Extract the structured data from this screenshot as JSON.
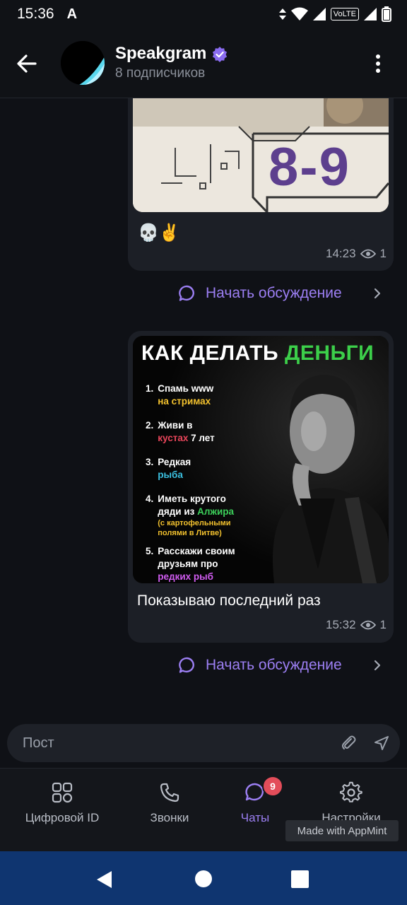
{
  "status_bar": {
    "time": "15:36",
    "volte": "VoLTE"
  },
  "header": {
    "channel_name": "Speakgram",
    "subscribers": "8 подписчиков"
  },
  "posts": [
    {
      "image_label": "8-9",
      "caption": "💀✌️",
      "time": "14:23",
      "views": "1",
      "discuss_label": "Начать обсуждение"
    },
    {
      "image": {
        "title_white": "КАК ДЕЛАТЬ",
        "title_green": "ДЕНЬГИ",
        "items": [
          {
            "num": "1.",
            "text": "Спамь www",
            "highlight": "на стримах",
            "after": "",
            "color": "#f2c12e"
          },
          {
            "num": "2.",
            "text": "Живи в",
            "highlight": "кустах",
            "after": " 7 лет",
            "color": "#e8455a"
          },
          {
            "num": "3.",
            "text": "Редкая",
            "highlight": "рыба",
            "after": "",
            "color": "#3bc0e0"
          },
          {
            "num": "4.",
            "text": "Иметь крутого дяди из",
            "highlight": "Алжира",
            "after": "",
            "color": "#3ccf5a",
            "note": "(с картофельными полями в Литве)"
          },
          {
            "num": "5.",
            "text": "Расскажи своим друзьям про",
            "highlight": "редких рыб",
            "after": "",
            "color": "#d05cf0"
          }
        ]
      },
      "caption": "Показываю последний раз",
      "time": "15:32",
      "views": "1",
      "discuss_label": "Начать обсуждение"
    }
  ],
  "input": {
    "placeholder": "Пост"
  },
  "nav": {
    "items": [
      {
        "label": "Цифровой ID",
        "icon": "grid-icon"
      },
      {
        "label": "Звонки",
        "icon": "phone-icon"
      },
      {
        "label": "Чаты",
        "icon": "chat-icon",
        "badge": "9",
        "active": true
      },
      {
        "label": "Настройки",
        "icon": "gear-icon"
      }
    ]
  },
  "watermark": "Made with AppMint",
  "colors": {
    "accent": "#9c7ff3",
    "badge": "#e34d5a",
    "system_nav": "#0f3570",
    "bubble": "#1c1f26"
  }
}
